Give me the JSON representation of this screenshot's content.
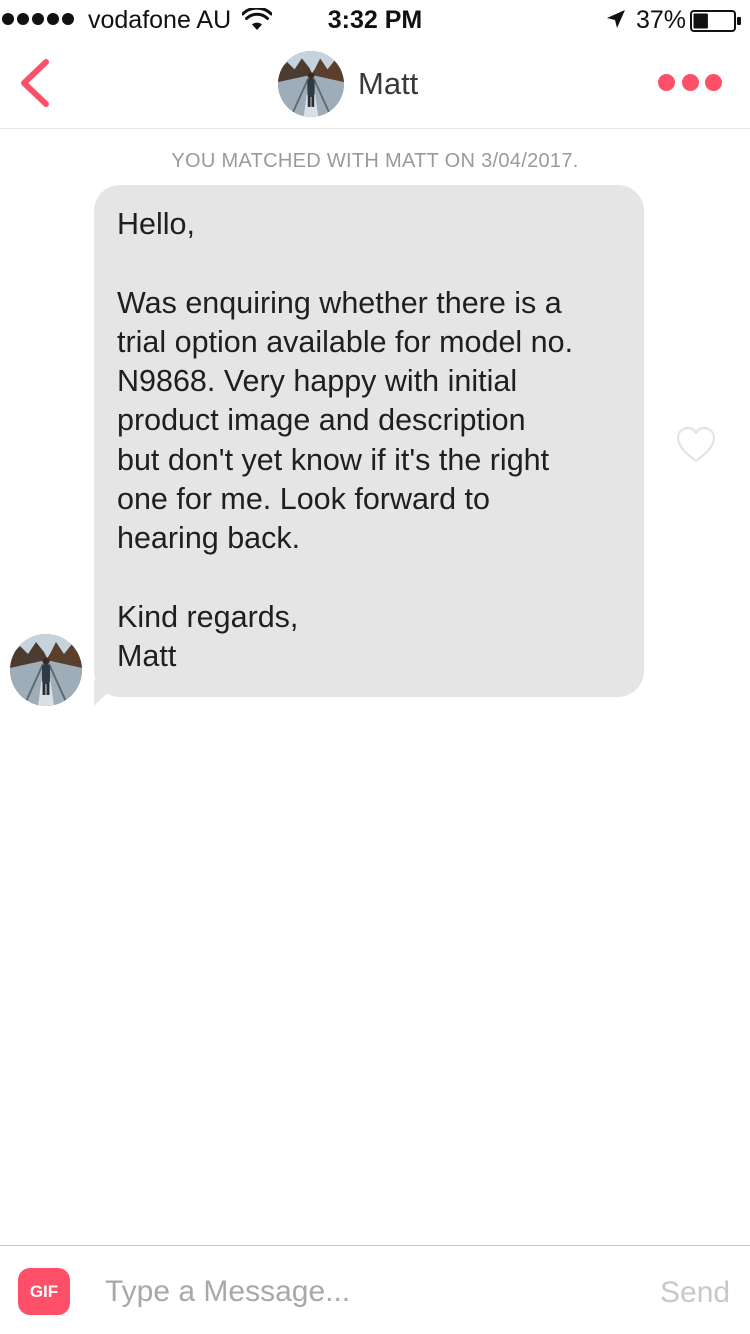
{
  "status_bar": {
    "carrier": "vodafone AU",
    "time": "3:32 PM",
    "battery_percent": "37%",
    "battery_level": 0.37,
    "signal_bars": 5,
    "icons": [
      "signal-dots",
      "wifi-icon",
      "location-arrow-icon",
      "battery-icon"
    ]
  },
  "header": {
    "back_icon": "chevron-left-icon",
    "contact_name": "Matt",
    "more_icon": "ellipsis-icon"
  },
  "conversation": {
    "match_notice": "YOU MATCHED WITH MATT ON 3/04/2017.",
    "messages": [
      {
        "sender": "Matt",
        "lines": [
          "Hello,",
          "",
          "Was enquiring whether there is a",
          "trial option available for model no.",
          "N9868. Very happy with initial",
          "product image and description",
          "but don't yet know if it's the right",
          "one for me. Look forward to",
          "hearing back.",
          "",
          "Kind regards,",
          "Matt"
        ],
        "like_icon": "heart-outline-icon"
      }
    ]
  },
  "composer": {
    "gif_label": "GIF",
    "input_placeholder": "Type a Message...",
    "input_value": "",
    "send_label": "Send"
  },
  "colors": {
    "accent": "#fd5068",
    "bubble": "#e5e5e5",
    "muted_text": "#9a9a9a",
    "send_disabled": "#c8c8c8"
  }
}
